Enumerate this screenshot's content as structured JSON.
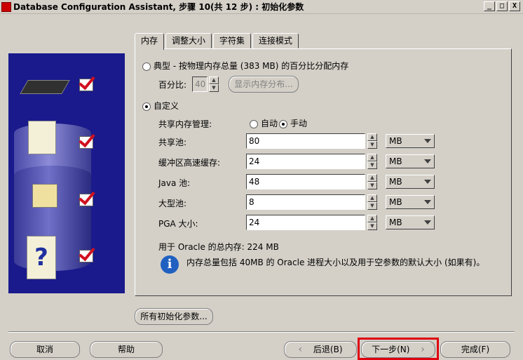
{
  "window": {
    "title": "Database Configuration Assistant, 步骤 10(共 12 步) : 初始化参数",
    "min": "_",
    "max": "□",
    "close": "X"
  },
  "tabs": [
    {
      "label": "内存",
      "active": true
    },
    {
      "label": "调整大小",
      "active": false
    },
    {
      "label": "字符集",
      "active": false
    },
    {
      "label": "连接模式",
      "active": false
    }
  ],
  "memory": {
    "typical_label": "典型 - 按物理内存总量 (383 MB) 的百分比分配内存",
    "percent_label": "百分比:",
    "percent_value": "40",
    "show_dist_button": "显示内存分布...",
    "custom_label": "自定义",
    "shared_mgmt_label": "共享内存管理:",
    "auto_label": "自动",
    "manual_label": "手动",
    "rows": [
      {
        "label": "共享池:",
        "value": "80",
        "unit": "MB"
      },
      {
        "label": "缓冲区高速缓存:",
        "value": "24",
        "unit": "MB"
      },
      {
        "label": "Java 池:",
        "value": "48",
        "unit": "MB"
      },
      {
        "label": "大型池:",
        "value": "8",
        "unit": "MB"
      },
      {
        "label": "PGA 大小:",
        "value": "24",
        "unit": "MB"
      }
    ],
    "total_label": "用于 Oracle 的总内存:  224 MB",
    "info_text": "内存总量包括 40MB 的 Oracle 进程大小以及用于空参数的默认大小 (如果有)。"
  },
  "all_params_button": "所有初始化参数...",
  "footer": {
    "cancel": "取消",
    "help": "帮助",
    "back": "后退(B)",
    "next": "下一步(N)",
    "finish": "完成(F)"
  },
  "icons": {
    "info": "i",
    "question": "?",
    "spin_up": "▲",
    "spin_down": "▼",
    "chev_left": "‹",
    "chev_right": "›"
  },
  "colors": {
    "panel_bg": "#d4d0c8",
    "side_bg": "#1a1a8c",
    "highlight": "#e00010"
  }
}
